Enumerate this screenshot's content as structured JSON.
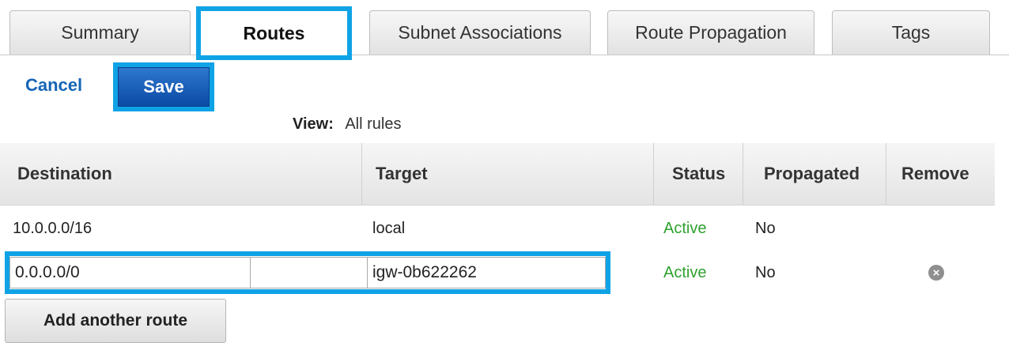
{
  "tabs": [
    {
      "label": "Summary",
      "active": false
    },
    {
      "label": "Routes",
      "active": true
    },
    {
      "label": "Subnet Associations",
      "active": false
    },
    {
      "label": "Route Propagation",
      "active": false
    },
    {
      "label": "Tags",
      "active": false
    }
  ],
  "actions": {
    "cancel_label": "Cancel",
    "save_label": "Save"
  },
  "view": {
    "label": "View:",
    "value": "All rules"
  },
  "table": {
    "headers": {
      "destination": "Destination",
      "target": "Target",
      "status": "Status",
      "propagated": "Propagated",
      "remove": "Remove"
    },
    "rows": [
      {
        "destination": "10.0.0.0/16",
        "target": "local",
        "status": "Active",
        "propagated": "No"
      }
    ],
    "edit_row": {
      "destination": "0.0.0.0/0",
      "target": "igw-0b622262",
      "status": "Active",
      "propagated": "No",
      "remove_icon": "remove-circle-x-icon"
    }
  },
  "add_route_label": "Add another route",
  "colors": {
    "highlight": "#0fa3e6",
    "link": "#1565b5",
    "save_button": "#0b4aa4",
    "status_active": "#2ea12e"
  }
}
